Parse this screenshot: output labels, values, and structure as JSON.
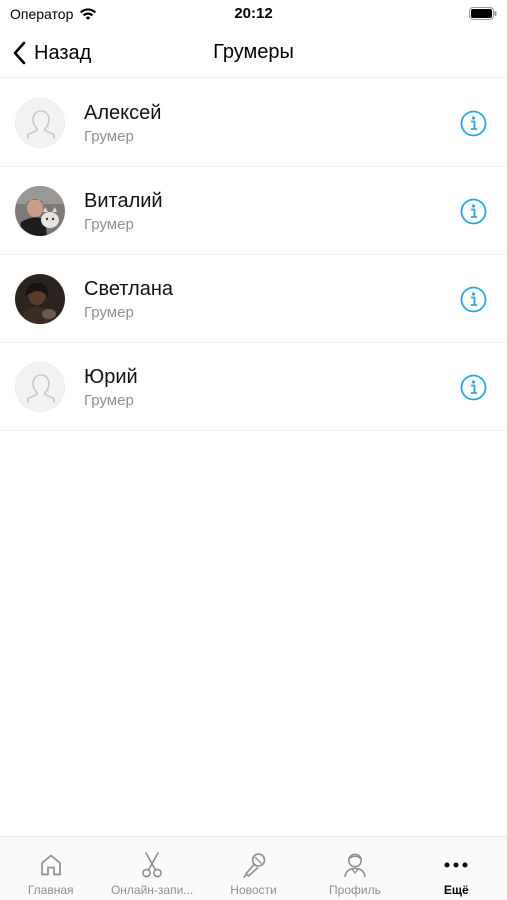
{
  "status_bar": {
    "carrier": "Оператор",
    "time": "20:12"
  },
  "nav": {
    "back_label": "Назад",
    "title": "Грумеры"
  },
  "groomers": [
    {
      "name": "Алексей",
      "role": "Грумер",
      "avatar": "placeholder"
    },
    {
      "name": "Виталий",
      "role": "Грумер",
      "avatar": "photo"
    },
    {
      "name": "Светлана",
      "role": "Грумер",
      "avatar": "photo"
    },
    {
      "name": "Юрий",
      "role": "Грумер",
      "avatar": "placeholder"
    }
  ],
  "tabs": [
    {
      "label": "Главная",
      "icon": "home-icon"
    },
    {
      "label": "Онлайн-запи...",
      "icon": "scissors-icon"
    },
    {
      "label": "Новости",
      "icon": "microphone-icon"
    },
    {
      "label": "Профиль",
      "icon": "person-icon"
    },
    {
      "label": "Ещё",
      "icon": "more-icon",
      "active": true
    }
  ],
  "colors": {
    "accent": "#2aa7dd",
    "secondary_text": "#8e8e93",
    "separator": "#efefef"
  }
}
